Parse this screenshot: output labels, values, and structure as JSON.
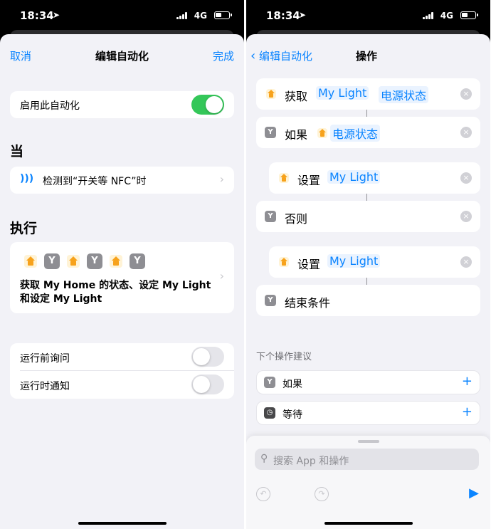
{
  "status_bar": {
    "time": "18:34",
    "network": "4G"
  },
  "left": {
    "nav": {
      "cancel": "取消",
      "title": "编辑自动化",
      "done": "完成"
    },
    "enable": {
      "label": "启用此自动化",
      "on": true
    },
    "section_when": "当",
    "trigger": {
      "label": "检测到“开关等 NFC”时"
    },
    "section_do": "执行",
    "summary": {
      "text": "获取 My Home 的状态、设定 My Light 和设定 My Light"
    },
    "ask_before": {
      "label": "运行前询问",
      "on": false
    },
    "notify": {
      "label": "运行时通知",
      "on": false
    }
  },
  "right": {
    "nav": {
      "back": "编辑自动化",
      "title": "操作"
    },
    "actions": [
      {
        "verb": "获取",
        "token1": "My Light",
        "token2": "电源状态"
      },
      {
        "verb": "如果",
        "token1": "电源状态"
      },
      {
        "verb": "设置",
        "token1": "My Light"
      },
      {
        "verb": "否则"
      },
      {
        "verb": "设置",
        "token1": "My Light"
      },
      {
        "verb": "结束条件"
      }
    ],
    "suggestions_title": "下个操作建议",
    "suggestions": [
      {
        "label": "如果"
      },
      {
        "label": "等待"
      }
    ],
    "search": {
      "placeholder": "搜索 App 和操作"
    }
  },
  "colors": {
    "accent": "#0a84ff",
    "toggle_on": "#34c759",
    "home_icon": "#f7a21b",
    "background": "#f2f2f7"
  }
}
